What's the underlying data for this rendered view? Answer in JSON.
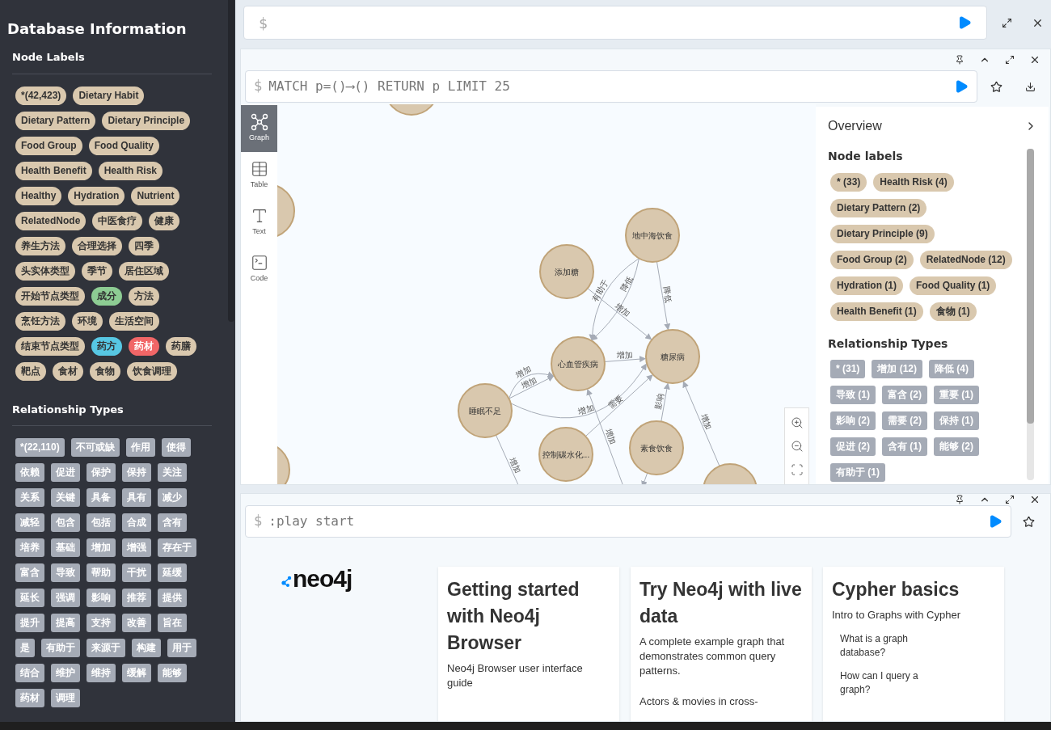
{
  "sidebar": {
    "title": "Database Information",
    "node_labels": {
      "heading": "Node Labels",
      "items": [
        {
          "label": "*(42,423)",
          "color": "#d9c8ae"
        },
        {
          "label": "Dietary Habit",
          "color": "#d9c8ae"
        },
        {
          "label": "Dietary Pattern",
          "color": "#d9c8ae"
        },
        {
          "label": "Dietary Principle",
          "color": "#d9c8ae"
        },
        {
          "label": "Food Group",
          "color": "#d9c8ae"
        },
        {
          "label": "Food Quality",
          "color": "#d9c8ae"
        },
        {
          "label": "Health Benefit",
          "color": "#d9c8ae"
        },
        {
          "label": "Health Risk",
          "color": "#d9c8ae"
        },
        {
          "label": "Healthy",
          "color": "#d9c8ae"
        },
        {
          "label": "Hydration",
          "color": "#d9c8ae"
        },
        {
          "label": "Nutrient",
          "color": "#d9c8ae"
        },
        {
          "label": "RelatedNode",
          "color": "#d9c8ae"
        },
        {
          "label": "中医食疗",
          "color": "#d9c8ae"
        },
        {
          "label": "健康",
          "color": "#d9c8ae"
        },
        {
          "label": "养生方法",
          "color": "#d9c8ae"
        },
        {
          "label": "合理选择",
          "color": "#d9c8ae"
        },
        {
          "label": "四季",
          "color": "#d9c8ae"
        },
        {
          "label": "头实体类型",
          "color": "#d9c8ae"
        },
        {
          "label": "季节",
          "color": "#d9c8ae"
        },
        {
          "label": "居住区域",
          "color": "#d9c8ae"
        },
        {
          "label": "开始节点类型",
          "color": "#d9c8ae"
        },
        {
          "label": "成分",
          "color": "#8dcc93"
        },
        {
          "label": "方法",
          "color": "#d9c8ae"
        },
        {
          "label": "烹饪方法",
          "color": "#d9c8ae"
        },
        {
          "label": "环境",
          "color": "#d9c8ae"
        },
        {
          "label": "生活空间",
          "color": "#d9c8ae"
        },
        {
          "label": "结束节点类型",
          "color": "#d9c8ae"
        },
        {
          "label": "药方",
          "color": "#57c7e3"
        },
        {
          "label": "药材",
          "color": "#f16667"
        },
        {
          "label": "药膳",
          "color": "#d9c8ae"
        },
        {
          "label": "靶点",
          "color": "#d9c8ae"
        },
        {
          "label": "食材",
          "color": "#d9c8ae"
        },
        {
          "label": "食物",
          "color": "#d9c8ae"
        },
        {
          "label": "饮食调理",
          "color": "#d9c8ae"
        }
      ]
    },
    "relationship_types": {
      "heading": "Relationship Types",
      "items": [
        "*(22,110)",
        "不可或缺",
        "作用",
        "使得",
        "依赖",
        "促进",
        "保护",
        "保持",
        "关注",
        "关系",
        "关键",
        "具备",
        "具有",
        "减少",
        "减轻",
        "包含",
        "包括",
        "合成",
        "含有",
        "培养",
        "基础",
        "增加",
        "增强",
        "存在于",
        "富含",
        "导致",
        "帮助",
        "干扰",
        "延缓",
        "延长",
        "强调",
        "影响",
        "推荐",
        "提供",
        "提升",
        "提高",
        "支持",
        "改善",
        "旨在",
        "是",
        "有助于",
        "来源于",
        "构建",
        "用于",
        "结合",
        "维护",
        "维持",
        "缓解",
        "能够",
        "药材",
        "调理"
      ]
    }
  },
  "top_editor": {
    "prompt": "$"
  },
  "result_frame": {
    "prompt": "$",
    "query": "MATCH p=()⟶() RETURN p LIMIT 25",
    "views": [
      {
        "label": "Graph",
        "kind": "graph",
        "selected": true
      },
      {
        "label": "Table",
        "kind": "table",
        "selected": false
      },
      {
        "label": "Text",
        "kind": "text",
        "selected": false
      },
      {
        "label": "Code",
        "kind": "code",
        "selected": false
      }
    ],
    "graph": {
      "nodes": [
        "地中海饮食",
        "添加糖",
        "心血管疾病",
        "糖尿病",
        "睡眠不足",
        "控制碳水化...",
        "素食饮食"
      ],
      "relationship_labels": [
        "有助于",
        "降低",
        "降低",
        "增加",
        "增加",
        "增加",
        "增加",
        "增加",
        "需要",
        "影响",
        "增加",
        "增加",
        "增加"
      ]
    },
    "overview": {
      "title": "Overview",
      "node_heading": "Node labels",
      "node_labels": [
        "* (33)",
        "Health Risk (4)",
        "Dietary Pattern (2)",
        "Dietary Principle (9)",
        "Food Group (2)",
        "RelatedNode (12)",
        "Hydration (1)",
        "Food Quality (1)",
        "Health Benefit (1)",
        "食物 (1)"
      ],
      "rel_heading": "Relationship Types",
      "rel_types": [
        "* (31)",
        "增加 (12)",
        "降低 (4)",
        "导致 (1)",
        "富含 (2)",
        "重要 (1)",
        "影响 (2)",
        "需要 (2)",
        "保持 (1)",
        "促进 (2)",
        "含有 (1)",
        "能够 (2)",
        "有助于 (1)"
      ]
    }
  },
  "guide_frame": {
    "prompt": "$",
    "command": ":play start",
    "logo": "neo4j",
    "cards": [
      {
        "title": "Getting started with Neo4j Browser",
        "subtitle": "Neo4j Browser user interface guide"
      },
      {
        "title": "Try Neo4j with live data",
        "subtitle": "A complete example graph that demonstrates common query patterns.",
        "extra": "Actors & movies in cross-"
      },
      {
        "title": "Cypher basics",
        "subtitle": "Intro to Graphs with Cypher",
        "links": [
          "What is a graph database?",
          "How can I query a graph?"
        ]
      }
    ]
  }
}
